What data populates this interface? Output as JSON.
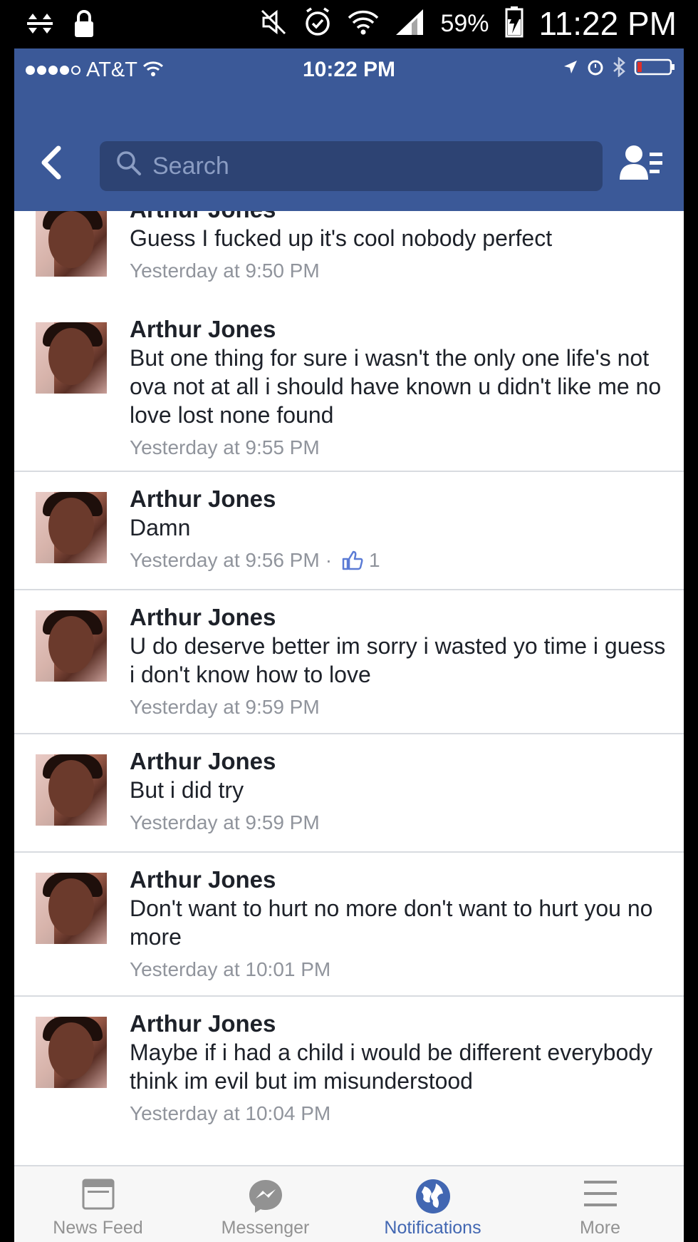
{
  "android_status": {
    "battery_percent": "59%",
    "time": "11:22 PM"
  },
  "ios_status": {
    "carrier": "AT&T",
    "time": "10:22 PM"
  },
  "search": {
    "placeholder": "Search"
  },
  "messages": [
    {
      "name": "Arthur Jones",
      "text": "Guess I fucked up it's cool nobody perfect",
      "timestamp": "Yesterday at 9:50 PM"
    },
    {
      "name": "Arthur Jones",
      "text": "But one thing for sure i wasn't the only one life's not ova not at all i should have known u didn't like me no love lost none found",
      "timestamp": "Yesterday at 9:55 PM"
    },
    {
      "name": "Arthur Jones",
      "text": "Damn",
      "timestamp": "Yesterday at 9:56 PM",
      "like_count": "1"
    },
    {
      "name": "Arthur Jones",
      "text": "U do deserve better im  sorry i wasted yo time i guess i don't know how to love",
      "timestamp": "Yesterday at 9:59 PM"
    },
    {
      "name": "Arthur Jones",
      "text": "But i did try",
      "timestamp": "Yesterday at 9:59 PM"
    },
    {
      "name": "Arthur Jones",
      "text": "Don't want to hurt no more don't want to hurt you no more",
      "timestamp": "Yesterday at 10:01 PM"
    },
    {
      "name": "Arthur Jones",
      "text": "Maybe if i had a child i would be different everybody think im evil but im misunderstood",
      "timestamp": "Yesterday at 10:04 PM"
    }
  ],
  "tabs": [
    {
      "label": "News Feed",
      "icon": "news-feed-icon"
    },
    {
      "label": "Messenger",
      "icon": "messenger-icon"
    },
    {
      "label": "Notifications",
      "icon": "globe-icon",
      "active": true
    },
    {
      "label": "More",
      "icon": "hamburger-icon"
    }
  ],
  "colors": {
    "brand_blue": "#3b5998",
    "active_tab": "#4267b2",
    "timestamp_gray": "#90949c"
  }
}
